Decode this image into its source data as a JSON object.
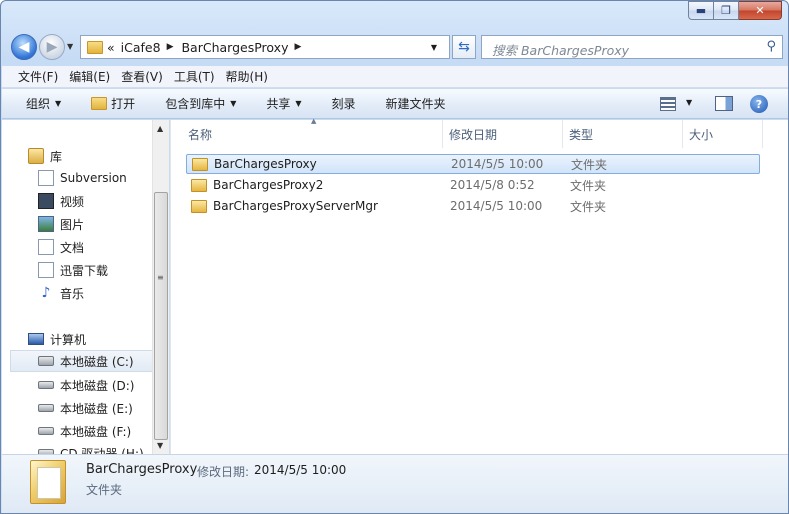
{
  "window": {
    "minimize": "▬",
    "maximize": "❐",
    "close": "✕"
  },
  "address": {
    "overflow": "«",
    "segments": [
      "iCafe8",
      "BarChargesProxy"
    ]
  },
  "search": {
    "placeholder": "搜索 BarChargesProxy"
  },
  "menu": [
    "文件(F)",
    "编辑(E)",
    "查看(V)",
    "工具(T)",
    "帮助(H)"
  ],
  "toolbar": {
    "organize": "组织",
    "open": "打开",
    "include": "包含到库中",
    "share": "共享",
    "burn": "刻录",
    "new_folder": "新建文件夹"
  },
  "nav": {
    "library": "库",
    "subversion": "Subversion",
    "videos": "视频",
    "pictures": "图片",
    "documents": "文档",
    "thunder": "迅雷下载",
    "music": "音乐",
    "computer": "计算机",
    "drive_c": "本地磁盘 (C:)",
    "drive_d": "本地磁盘 (D:)",
    "drive_e": "本地磁盘 (E:)",
    "drive_f": "本地磁盘 (F:)",
    "cd_drive": "CD 驱动器 (H:)"
  },
  "columns": {
    "name": "名称",
    "modified": "修改日期",
    "type": "类型",
    "size": "大小"
  },
  "files": [
    {
      "name": "BarChargesProxy",
      "modified": "2014/5/5 10:00",
      "type": "文件夹"
    },
    {
      "name": "BarChargesProxy2",
      "modified": "2014/5/8 0:52",
      "type": "文件夹"
    },
    {
      "name": "BarChargesProxyServerMgr",
      "modified": "2014/5/5 10:00",
      "type": "文件夹"
    }
  ],
  "details": {
    "name": "BarChargesProxy",
    "modified_label": "修改日期:",
    "modified_value": "2014/5/5 10:00",
    "type": "文件夹"
  }
}
